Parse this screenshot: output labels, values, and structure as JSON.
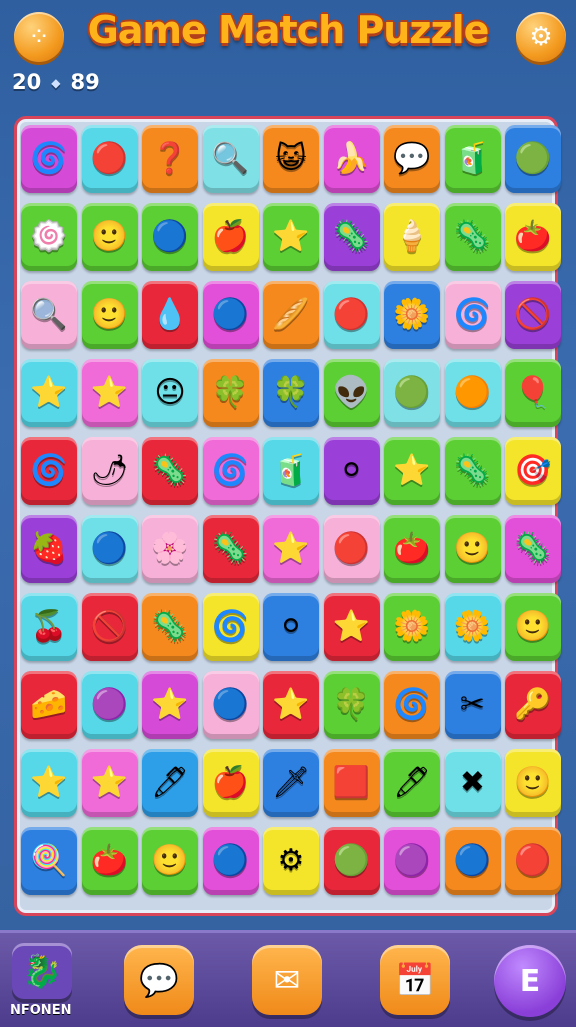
{
  "header": {
    "title": "Game Match Puzzle",
    "score_left": "20",
    "score_right": "89",
    "menu_icon": "dots-icon",
    "settings_icon": "gear-icon"
  },
  "board": {
    "rows": [
      [
        [
          "#d64ad8",
          "🌀"
        ],
        [
          "#56d8e8",
          "🔴"
        ],
        [
          "#f5891e",
          "❓"
        ],
        [
          "#7fe0e6",
          "🔍"
        ],
        [
          "#f5891e",
          "😺"
        ],
        [
          "#e24fd8",
          "🍌"
        ],
        [
          "#f5891e",
          "💬"
        ],
        [
          "#5ccf34",
          "🧃"
        ],
        [
          "#2d7fe0",
          "🟢"
        ]
      ],
      [
        [
          "#5ccf34",
          "🍥"
        ],
        [
          "#5ccf34",
          "🙂"
        ],
        [
          "#5ccf34",
          "🔵"
        ],
        [
          "#f4e52a",
          "🍎"
        ],
        [
          "#5ccf34",
          "⭐"
        ],
        [
          "#9a3fd8",
          "🦠"
        ],
        [
          "#f4e52a",
          "🍦"
        ],
        [
          "#5ccf34",
          "🦠"
        ],
        [
          "#f4e52a",
          "🍅"
        ]
      ],
      [
        [
          "#f7b0d8",
          "🔍"
        ],
        [
          "#5ccf34",
          "🙂"
        ],
        [
          "#e8283a",
          "💧"
        ],
        [
          "#e24fd8",
          "🔵"
        ],
        [
          "#f5891e",
          "🥖"
        ],
        [
          "#6fe0e8",
          "🔴"
        ],
        [
          "#2d7fe0",
          "🌼"
        ],
        [
          "#f7b0d8",
          "🌀"
        ],
        [
          "#9a3fd8",
          "🚫"
        ]
      ],
      [
        [
          "#56d8e8",
          "⭐"
        ],
        [
          "#f06ad8",
          "⭐"
        ],
        [
          "#6fe0e8",
          "😐"
        ],
        [
          "#f5891e",
          "🍀"
        ],
        [
          "#2d7fe0",
          "🍀"
        ],
        [
          "#5ccf34",
          "👽"
        ],
        [
          "#7fe0e6",
          "🟢"
        ],
        [
          "#6fe0e8",
          "🟠"
        ],
        [
          "#5ccf34",
          "🎈"
        ]
      ],
      [
        [
          "#e8283a",
          "🌀"
        ],
        [
          "#f7b0d8",
          "🌶"
        ],
        [
          "#e8283a",
          "🦠"
        ],
        [
          "#f06ad8",
          "🌀"
        ],
        [
          "#56d8e8",
          "🧃"
        ],
        [
          "#9a3fd8",
          "⚪"
        ],
        [
          "#5ccf34",
          "⭐"
        ],
        [
          "#5ccf34",
          "🦠"
        ],
        [
          "#f4e52a",
          "🎯"
        ]
      ],
      [
        [
          "#9a3fd8",
          "🍓"
        ],
        [
          "#6fe0e8",
          "🔵"
        ],
        [
          "#f7b0d8",
          "🌸"
        ],
        [
          "#e8283a",
          "🦠"
        ],
        [
          "#f06ad8",
          "⭐"
        ],
        [
          "#f7b0d8",
          "🔴"
        ],
        [
          "#5ccf34",
          "🍅"
        ],
        [
          "#5ccf34",
          "🙂"
        ],
        [
          "#e24fd8",
          "🦠"
        ]
      ],
      [
        [
          "#56d8e8",
          "🍒"
        ],
        [
          "#e8283a",
          "🚫"
        ],
        [
          "#f5891e",
          "🦠"
        ],
        [
          "#f4e52a",
          "🌀"
        ],
        [
          "#2d7fe0",
          "⚪"
        ],
        [
          "#e8283a",
          "⭐"
        ],
        [
          "#5ccf34",
          "🌼"
        ],
        [
          "#56d8e8",
          "🌼"
        ],
        [
          "#5ccf34",
          "🙂"
        ]
      ],
      [
        [
          "#e8283a",
          "🧀"
        ],
        [
          "#56d8e8",
          "🟣"
        ],
        [
          "#d64ad8",
          "⭐"
        ],
        [
          "#f7b0d8",
          "🔵"
        ],
        [
          "#e8283a",
          "⭐"
        ],
        [
          "#5ccf34",
          "🍀"
        ],
        [
          "#f5891e",
          "🌀"
        ],
        [
          "#2d7fe0",
          "✂"
        ],
        [
          "#e8283a",
          "🔑"
        ]
      ],
      [
        [
          "#56d8e8",
          "⭐"
        ],
        [
          "#f06ad8",
          "⭐"
        ],
        [
          "#2d9ee8",
          "🖊"
        ],
        [
          "#f4e52a",
          "🍎"
        ],
        [
          "#2d7fe0",
          "🗡"
        ],
        [
          "#f5891e",
          "🟥"
        ],
        [
          "#5ccf34",
          "🖊"
        ],
        [
          "#6fe0e8",
          "✖"
        ],
        [
          "#f4e52a",
          "🙂"
        ]
      ],
      [
        [
          "#2d7fe0",
          "🍭"
        ],
        [
          "#5ccf34",
          "🍅"
        ],
        [
          "#5ccf34",
          "🙂"
        ],
        [
          "#e24fd8",
          "🔵"
        ],
        [
          "#f4e52a",
          "⚙"
        ],
        [
          "#e8283a",
          "🟢"
        ],
        [
          "#e24fd8",
          "🟣"
        ],
        [
          "#f5891e",
          "🔵"
        ],
        [
          "#f5891e",
          "🔴"
        ]
      ]
    ]
  },
  "bottom": {
    "profile_label": "NFONEN",
    "profile_icon": "dragon-icon",
    "hint_icon": "heart-bubble-icon",
    "mail_icon": "envelope-icon",
    "calendar_icon": "calendar-icon",
    "list_label": "E"
  }
}
